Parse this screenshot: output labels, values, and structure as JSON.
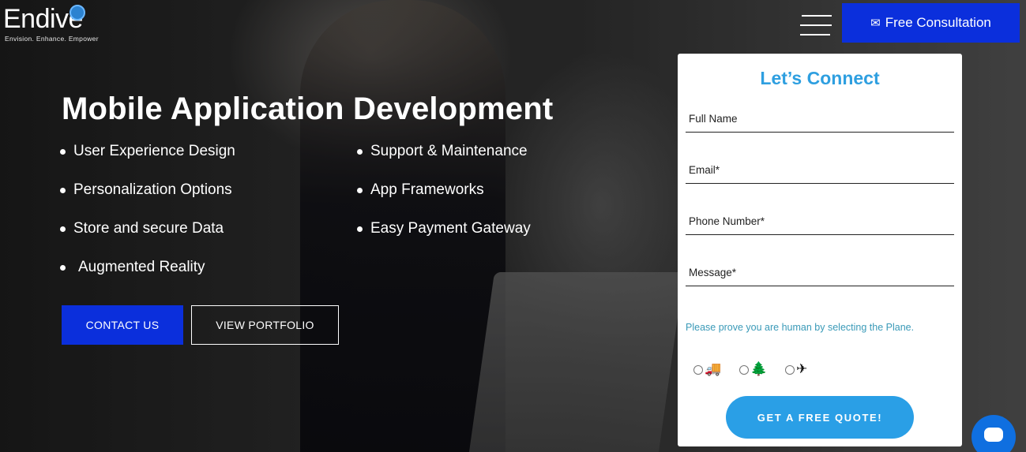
{
  "brand": {
    "logo_word": "Endive",
    "tagline": "Envision. Enhance. Empower"
  },
  "header": {
    "menu_icon": "hamburger-icon",
    "consult_icon": "envelope-icon",
    "consult_label": "Free Consultation"
  },
  "hero": {
    "title": "Mobile Application Development",
    "features": [
      "User Experience Design",
      "Personalization Options",
      "Store and secure Data",
      "Augmented Reality",
      "Support & Maintenance",
      "App Frameworks",
      "Easy Payment Gateway"
    ],
    "contact_label": "CONTACT US",
    "portfolio_label": "VIEW PORTFOLIO"
  },
  "form": {
    "title": "Let’s Connect",
    "fields": {
      "name_placeholder": "Full Name",
      "email_placeholder": "Email*",
      "phone_placeholder": "Phone Number*",
      "message_placeholder": "Message*"
    },
    "captcha_text": "Please prove you are human by selecting the Plane.",
    "captcha_options": [
      {
        "icon": "truck-icon",
        "glyph": "🚚"
      },
      {
        "icon": "tree-icon",
        "glyph": "🌲"
      },
      {
        "icon": "plane-icon",
        "glyph": "✈"
      }
    ],
    "submit_label": "GET A FREE QUOTE!"
  },
  "chat": {
    "icon": "chat-bubble-icon"
  },
  "colors": {
    "primary_blue": "#0b2fdc",
    "accent_blue": "#2a9fe6",
    "title_blue": "#2e9fe0",
    "captcha_text": "#3a9ab8"
  }
}
